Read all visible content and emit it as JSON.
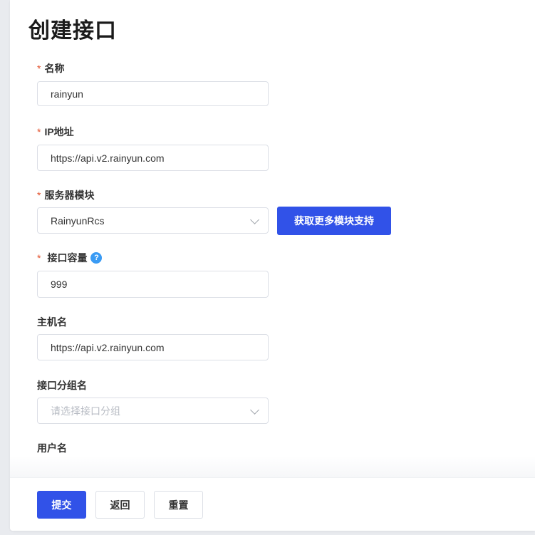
{
  "page": {
    "title": "创建接口"
  },
  "form": {
    "required_mark": "*",
    "name": {
      "label": "名称",
      "value": "rainyun"
    },
    "ip": {
      "label": "IP地址",
      "value": "https://api.v2.rainyun.com"
    },
    "module": {
      "label": "服务器模块",
      "value": "RainyunRcs",
      "more_button": "获取更多模块支持"
    },
    "capacity": {
      "label": "接口容量",
      "help_icon": "?",
      "value": "999"
    },
    "hostname": {
      "label": "主机名",
      "value": "https://api.v2.rainyun.com"
    },
    "group": {
      "label": "接口分组名",
      "placeholder": "请选择接口分组"
    },
    "username": {
      "label": "用户名"
    }
  },
  "footer": {
    "submit": "提交",
    "back": "返回",
    "reset": "重置"
  },
  "colors": {
    "primary": "#3152e8",
    "required": "#e2502c",
    "help": "#3a9bf4"
  }
}
